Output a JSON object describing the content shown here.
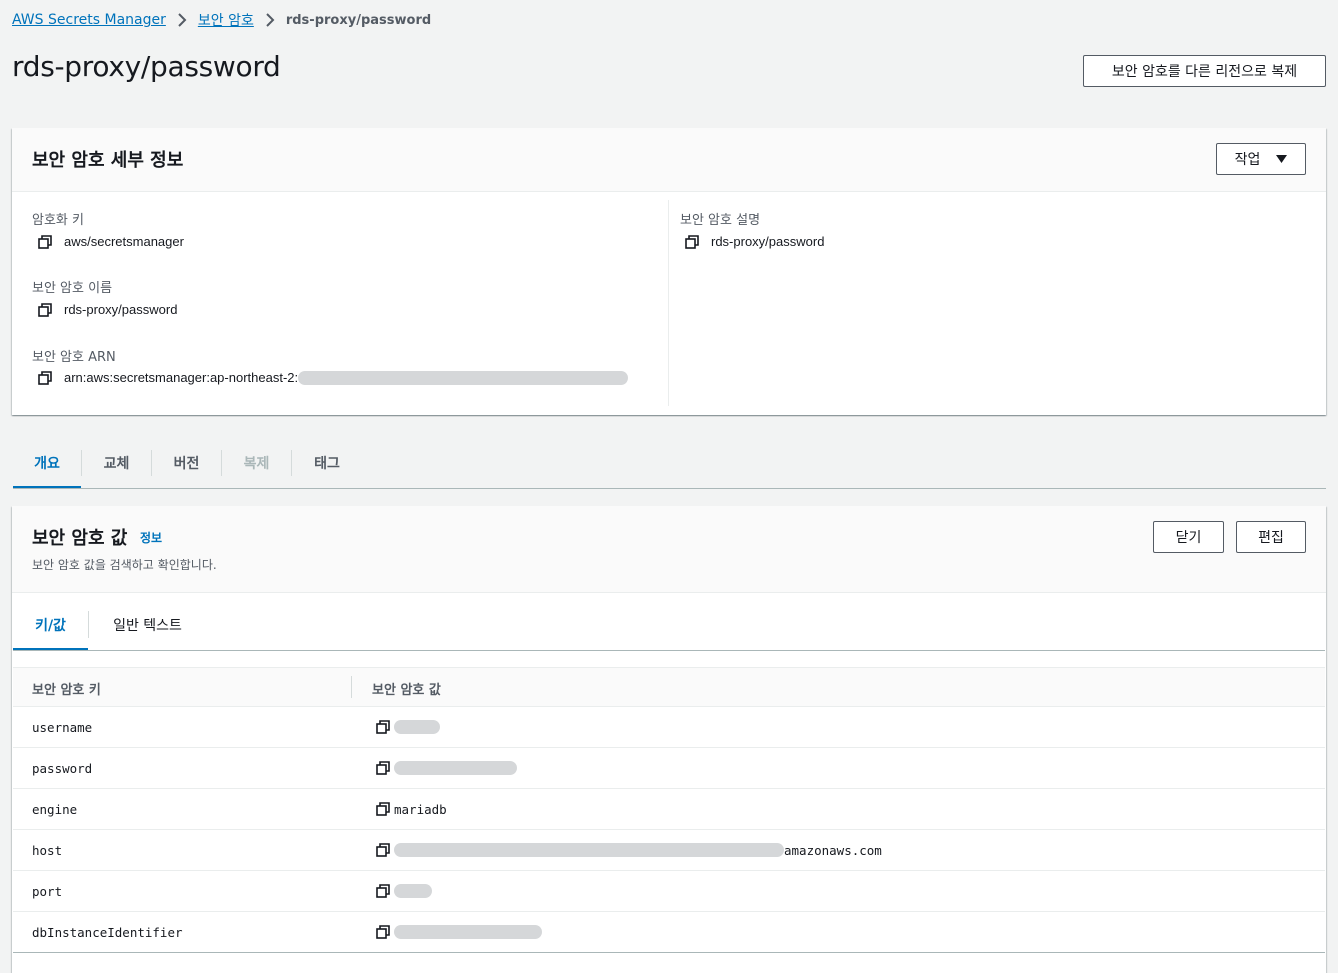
{
  "breadcrumb": {
    "items": [
      "AWS Secrets Manager",
      "보안 암호"
    ],
    "current": "rds-proxy/password"
  },
  "page": {
    "title": "rds-proxy/password",
    "replicate_button": "보안 암호를 다른 리전으로 복제"
  },
  "details": {
    "title": "보안 암호 세부 정보",
    "actions_button": "작업",
    "encryption_key_label": "암호화 키",
    "encryption_key_value": "aws/secretsmanager",
    "secret_name_label": "보안 암호 이름",
    "secret_name_value": "rds-proxy/password",
    "arn_label": "보안 암호 ARN",
    "arn_value": "arn:aws:secretsmanager:ap-northeast-2:",
    "description_label": "보안 암호 설명",
    "description_value": "rds-proxy/password"
  },
  "tabs": [
    {
      "label": "개요",
      "state": "active"
    },
    {
      "label": "교체",
      "state": "normal"
    },
    {
      "label": "버전",
      "state": "normal"
    },
    {
      "label": "복제",
      "state": "disabled"
    },
    {
      "label": "태그",
      "state": "normal"
    }
  ],
  "secret_value": {
    "title": "보안 암호 값",
    "info_link": "정보",
    "description": "보안 암호 값을 검색하고 확인합니다.",
    "close_button": "닫기",
    "edit_button": "편집",
    "subtabs": [
      {
        "label": "키/값",
        "state": "active"
      },
      {
        "label": "일반 텍스트",
        "state": "normal"
      }
    ],
    "columns": [
      "보안 암호 키",
      "보안 암호 값"
    ],
    "rows": [
      {
        "key": "username",
        "value": ""
      },
      {
        "key": "password",
        "value": ""
      },
      {
        "key": "engine",
        "value": "mariadb"
      },
      {
        "key": "host",
        "value": "amazonaws.com"
      },
      {
        "key": "port",
        "value": ""
      },
      {
        "key": "dbInstanceIdentifier",
        "value": ""
      }
    ]
  },
  "colors": {
    "link": "#0073bb",
    "background": "#f2f3f3",
    "redaction": "#d5d7d9"
  }
}
